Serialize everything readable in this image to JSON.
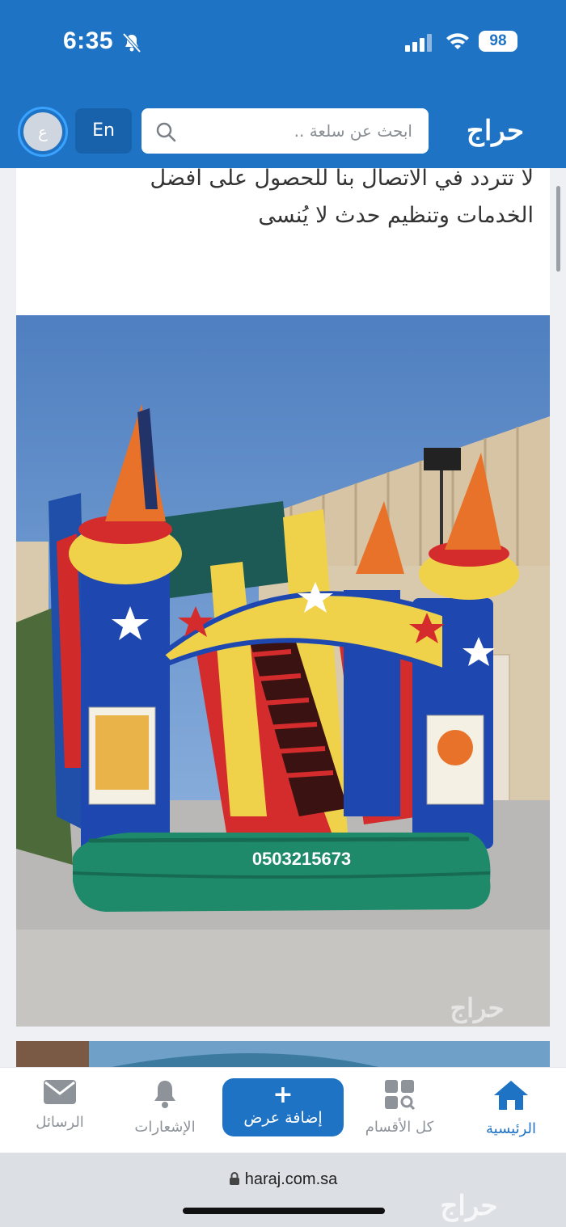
{
  "status_bar": {
    "time": "6:35",
    "battery": "98"
  },
  "header": {
    "avatar_letter": "ع",
    "language_button": "En",
    "search_placeholder": "ابحث عن سلعة ..",
    "logo": "حراج"
  },
  "post": {
    "description_lines": [
      "لا تتردد في الاتصال بنا للحصول على أفضل",
      "الخدمات وتنظيم حدث لا يُنسى"
    ],
    "image_phone": "0503215673",
    "image_watermark": "حراج"
  },
  "bottom_nav": {
    "home": "الرئيسية",
    "categories": "كل الأقسام",
    "add_offer": "إضافة عرض",
    "add_plus": "+",
    "notifications": "الإشعارات",
    "messages": "الرسائل"
  },
  "browser": {
    "url": "haraj.com.sa",
    "watermark": "حراج"
  },
  "colors": {
    "brand": "#1f73c4",
    "nav_inactive": "#8e939a",
    "background": "#eef0f3"
  }
}
